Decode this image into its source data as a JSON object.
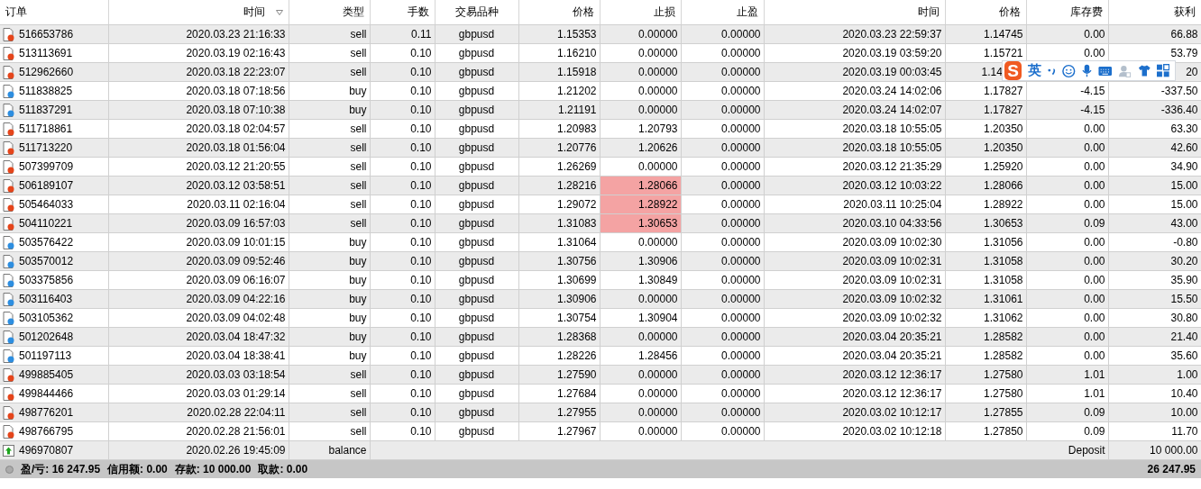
{
  "table": {
    "columns": [
      {
        "label": "订单",
        "sorted": false
      },
      {
        "label": "时间",
        "sorted": true
      },
      {
        "label": "类型",
        "sorted": false
      },
      {
        "label": "手数",
        "sorted": false
      },
      {
        "label": "交易品种",
        "sorted": false
      },
      {
        "label": "价格",
        "sorted": false
      },
      {
        "label": "止损",
        "sorted": false
      },
      {
        "label": "止盈",
        "sorted": false
      },
      {
        "label": "时间",
        "sorted": false
      },
      {
        "label": "价格",
        "sorted": false
      },
      {
        "label": "库存费",
        "sorted": false
      },
      {
        "label": "获利",
        "sorted": false
      }
    ],
    "rows": [
      {
        "kind": "sell",
        "cells": [
          "516653786",
          "2020.03.23 21:16:33",
          "sell",
          "0.11",
          "gbpusd",
          "1.15353",
          "0.00000",
          "0.00000",
          "2020.03.23 22:59:37",
          "1.14745",
          "0.00",
          "66.88"
        ],
        "sl_hit": false
      },
      {
        "kind": "sell",
        "cells": [
          "513113691",
          "2020.03.19 02:16:43",
          "sell",
          "0.10",
          "gbpusd",
          "1.16210",
          "0.00000",
          "0.00000",
          "2020.03.19 03:59:20",
          "1.15721",
          "0.00",
          "53.79"
        ],
        "sl_hit": false
      },
      {
        "kind": "sell",
        "cells": [
          "512962660",
          "2020.03.18 22:23:07",
          "sell",
          "0.10",
          "gbpusd",
          "1.15918",
          "0.00000",
          "0.00000",
          "2020.03.19 00:03:45",
          "1.14",
          null,
          "20"
        ],
        "sl_hit": false,
        "under_toolbar": true
      },
      {
        "kind": "buy",
        "cells": [
          "511838825",
          "2020.03.18 07:18:56",
          "buy",
          "0.10",
          "gbpusd",
          "1.21202",
          "0.00000",
          "0.00000",
          "2020.03.24 14:02:06",
          "1.17827",
          "-4.15",
          "-337.50"
        ],
        "sl_hit": false
      },
      {
        "kind": "buy",
        "cells": [
          "511837291",
          "2020.03.18 07:10:38",
          "buy",
          "0.10",
          "gbpusd",
          "1.21191",
          "0.00000",
          "0.00000",
          "2020.03.24 14:02:07",
          "1.17827",
          "-4.15",
          "-336.40"
        ],
        "sl_hit": false
      },
      {
        "kind": "sell",
        "cells": [
          "511718861",
          "2020.03.18 02:04:57",
          "sell",
          "0.10",
          "gbpusd",
          "1.20983",
          "1.20793",
          "0.00000",
          "2020.03.18 10:55:05",
          "1.20350",
          "0.00",
          "63.30"
        ],
        "sl_hit": false
      },
      {
        "kind": "sell",
        "cells": [
          "511713220",
          "2020.03.18 01:56:04",
          "sell",
          "0.10",
          "gbpusd",
          "1.20776",
          "1.20626",
          "0.00000",
          "2020.03.18 10:55:05",
          "1.20350",
          "0.00",
          "42.60"
        ],
        "sl_hit": false
      },
      {
        "kind": "sell",
        "cells": [
          "507399709",
          "2020.03.12 21:20:55",
          "sell",
          "0.10",
          "gbpusd",
          "1.26269",
          "0.00000",
          "0.00000",
          "2020.03.12 21:35:29",
          "1.25920",
          "0.00",
          "34.90"
        ],
        "sl_hit": false
      },
      {
        "kind": "sell",
        "cells": [
          "506189107",
          "2020.03.12 03:58:51",
          "sell",
          "0.10",
          "gbpusd",
          "1.28216",
          "1.28066",
          "0.00000",
          "2020.03.12 10:03:22",
          "1.28066",
          "0.00",
          "15.00"
        ],
        "sl_hit": true
      },
      {
        "kind": "sell",
        "cells": [
          "505464033",
          "2020.03.11 02:16:04",
          "sell",
          "0.10",
          "gbpusd",
          "1.29072",
          "1.28922",
          "0.00000",
          "2020.03.11 10:25:04",
          "1.28922",
          "0.00",
          "15.00"
        ],
        "sl_hit": true
      },
      {
        "kind": "sell",
        "cells": [
          "504110221",
          "2020.03.09 16:57:03",
          "sell",
          "0.10",
          "gbpusd",
          "1.31083",
          "1.30653",
          "0.00000",
          "2020.03.10 04:33:56",
          "1.30653",
          "0.09",
          "43.00"
        ],
        "sl_hit": true
      },
      {
        "kind": "buy",
        "cells": [
          "503576422",
          "2020.03.09 10:01:15",
          "buy",
          "0.10",
          "gbpusd",
          "1.31064",
          "0.00000",
          "0.00000",
          "2020.03.09 10:02:30",
          "1.31056",
          "0.00",
          "-0.80"
        ],
        "sl_hit": false
      },
      {
        "kind": "buy",
        "cells": [
          "503570012",
          "2020.03.09 09:52:46",
          "buy",
          "0.10",
          "gbpusd",
          "1.30756",
          "1.30906",
          "0.00000",
          "2020.03.09 10:02:31",
          "1.31058",
          "0.00",
          "30.20"
        ],
        "sl_hit": false
      },
      {
        "kind": "buy",
        "cells": [
          "503375856",
          "2020.03.09 06:16:07",
          "buy",
          "0.10",
          "gbpusd",
          "1.30699",
          "1.30849",
          "0.00000",
          "2020.03.09 10:02:31",
          "1.31058",
          "0.00",
          "35.90"
        ],
        "sl_hit": false
      },
      {
        "kind": "buy",
        "cells": [
          "503116403",
          "2020.03.09 04:22:16",
          "buy",
          "0.10",
          "gbpusd",
          "1.30906",
          "0.00000",
          "0.00000",
          "2020.03.09 10:02:32",
          "1.31061",
          "0.00",
          "15.50"
        ],
        "sl_hit": false
      },
      {
        "kind": "buy",
        "cells": [
          "503105362",
          "2020.03.09 04:02:48",
          "buy",
          "0.10",
          "gbpusd",
          "1.30754",
          "1.30904",
          "0.00000",
          "2020.03.09 10:02:32",
          "1.31062",
          "0.00",
          "30.80"
        ],
        "sl_hit": false
      },
      {
        "kind": "buy",
        "cells": [
          "501202648",
          "2020.03.04 18:47:32",
          "buy",
          "0.10",
          "gbpusd",
          "1.28368",
          "0.00000",
          "0.00000",
          "2020.03.04 20:35:21",
          "1.28582",
          "0.00",
          "21.40"
        ],
        "sl_hit": false
      },
      {
        "kind": "buy",
        "cells": [
          "501197113",
          "2020.03.04 18:38:41",
          "buy",
          "0.10",
          "gbpusd",
          "1.28226",
          "1.28456",
          "0.00000",
          "2020.03.04 20:35:21",
          "1.28582",
          "0.00",
          "35.60"
        ],
        "sl_hit": false
      },
      {
        "kind": "sell",
        "cells": [
          "499885405",
          "2020.03.03 03:18:54",
          "sell",
          "0.10",
          "gbpusd",
          "1.27590",
          "0.00000",
          "0.00000",
          "2020.03.12 12:36:17",
          "1.27580",
          "1.01",
          "1.00"
        ],
        "sl_hit": false
      },
      {
        "kind": "sell",
        "cells": [
          "499844466",
          "2020.03.03 01:29:14",
          "sell",
          "0.10",
          "gbpusd",
          "1.27684",
          "0.00000",
          "0.00000",
          "2020.03.12 12:36:17",
          "1.27580",
          "1.01",
          "10.40"
        ],
        "sl_hit": false
      },
      {
        "kind": "sell",
        "cells": [
          "498776201",
          "2020.02.28 22:04:11",
          "sell",
          "0.10",
          "gbpusd",
          "1.27955",
          "0.00000",
          "0.00000",
          "2020.03.02 10:12:17",
          "1.27855",
          "0.09",
          "10.00"
        ],
        "sl_hit": false
      },
      {
        "kind": "sell",
        "cells": [
          "498766795",
          "2020.02.28 21:56:01",
          "sell",
          "0.10",
          "gbpusd",
          "1.27967",
          "0.00000",
          "0.00000",
          "2020.03.02 10:12:18",
          "1.27850",
          "0.09",
          "11.70"
        ],
        "sl_hit": false
      },
      {
        "kind": "balance",
        "cells": [
          "496970807",
          "2020.02.26 19:45:09",
          "balance"
        ],
        "comment": "Deposit",
        "amount": "10 000.00"
      }
    ]
  },
  "summary": {
    "items": [
      "盈/亏: 16 247.95",
      "信用额: 0.00",
      "存款: 10 000.00",
      "取款: 0.00"
    ],
    "total": "26 247.95"
  },
  "ime_toolbar": {
    "logo": "S",
    "mode": "英"
  }
}
